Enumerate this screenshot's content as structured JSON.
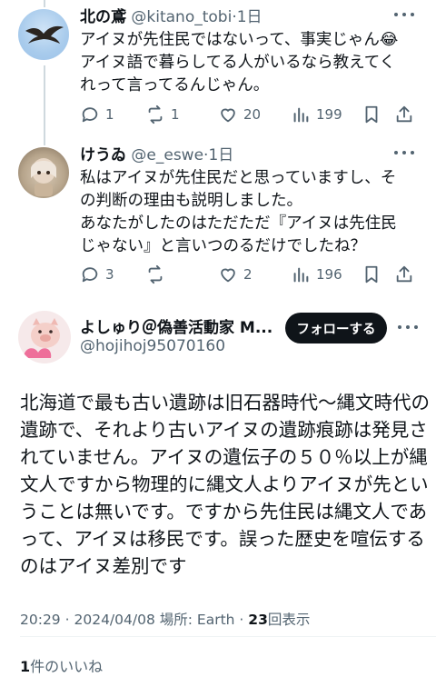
{
  "replies": [
    {
      "name": "北の鳶",
      "handle": "@kitano_tobi",
      "time": "1日",
      "lines": [
        "アイヌが先住民ではないって、事実じゃん😂",
        "アイヌ語で暮らしてる人がいるなら教えてく",
        "れって言ってるんじゃん。"
      ],
      "replies_count": "1",
      "reposts_count": "1",
      "likes_count": "20",
      "views_count": "199"
    },
    {
      "name": "けうゐ",
      "handle": "@e_eswe",
      "time": "1日",
      "lines": [
        "私はアイヌが先住民だと思っていますし、そ",
        "の判断の理由も説明しました。",
        "あなたがしたのはただただ『アイヌは先住民",
        "じゃない』と言いつのるだけでしたね？"
      ],
      "replies_count": "3",
      "reposts_count": "",
      "likes_count": "2",
      "views_count": "196"
    }
  ],
  "main_post": {
    "name": "よしゅり＠偽善活動家 M...",
    "handle": "@hojihoj95070160",
    "follow_label": "フォローする",
    "lines": [
      "北海道で最も古い遺跡は旧石器時代〜縄文時代の",
      "遺跡で、それより古いアイヌの遺跡痕跡は発見さ",
      "れていません。アイヌの遺伝子の５０％以上が縄",
      "文人ですから物理的に縄文人よりアイヌが先とい",
      "うことは無いです。ですから先住民は縄文人であ",
      "って、アイヌは移民です。誤った歴史を喧伝する",
      "のはアイヌ差別です"
    ],
    "time": "20:29",
    "date": "2024/04/08",
    "location_label": "場所: Earth",
    "views_count": "23",
    "views_label": "回表示",
    "likes_count": "1",
    "likes_label": "件のいいね"
  },
  "icons": [
    "reply-icon",
    "repost-icon",
    "like-icon",
    "views-icon",
    "bookmark-icon",
    "share-icon",
    "more-icon"
  ]
}
